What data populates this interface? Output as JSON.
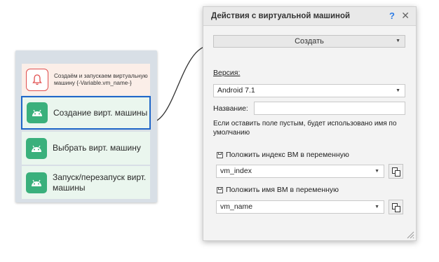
{
  "flow": {
    "blocks": [
      {
        "label": "Создаём и запускаем виртуальную машину {-Variable.vm_name-}",
        "icon": "bell-icon"
      },
      {
        "label": "Создание вирт. машины",
        "icon": "android-icon",
        "selected": true
      },
      {
        "label": "Выбрать вирт. машину",
        "icon": "android-icon"
      },
      {
        "label": "Запуск/перезапуск вирт. машины",
        "icon": "android-icon"
      }
    ]
  },
  "dialog": {
    "title": "Действия с виртуальной машиной",
    "help": "?",
    "close": "✕",
    "action": "Создать",
    "version_label": "Версия:",
    "version_value": "Android 7.1",
    "name_label": "Название:",
    "name_value": "",
    "hint": "Если оставить поле пустым, будет использовано имя по умолчанию",
    "index_label": "Положить индекс ВМ в переменную",
    "index_value": "vm_index",
    "name_var_label": "Положить имя ВМ в переменную",
    "name_var_value": "vm_name"
  },
  "colors": {
    "accent": "#1f66c8",
    "block_green": "#3ab07c",
    "note_red": "#e04e4e"
  }
}
